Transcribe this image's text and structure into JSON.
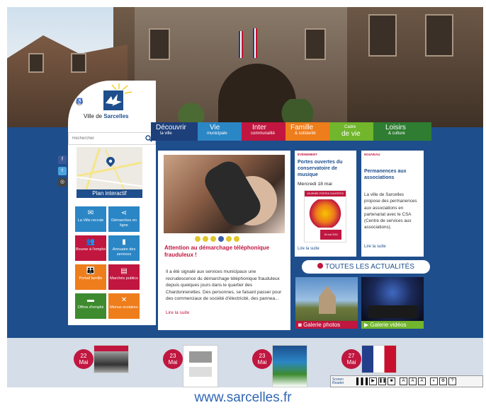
{
  "site": {
    "logo_text_prefix": "Ville de ",
    "logo_text_name": "Sarcelles",
    "footer_url": "www.sarcelles.fr"
  },
  "search": {
    "placeholder": "Rechercher"
  },
  "map": {
    "label": "Plan interactif"
  },
  "social": [
    {
      "name": "facebook",
      "glyph": "f",
      "color": "#3b5998"
    },
    {
      "name": "twitter",
      "glyph": "t",
      "color": "#4aa3df"
    },
    {
      "name": "instagram",
      "glyph": "◎",
      "color": "#444444"
    }
  ],
  "tiles": [
    {
      "label": "La Ville recrute",
      "glyph": "✉",
      "color": "#2b86c5"
    },
    {
      "label": "Démarches en ligne",
      "glyph": "⋖",
      "color": "#2b86c5"
    },
    {
      "label": "Bourse à l'emploi",
      "glyph": "👥",
      "color": "#c0163f"
    },
    {
      "label": "Annuaire des services",
      "glyph": "▮",
      "color": "#2b86c5"
    },
    {
      "label": "Portail famille",
      "glyph": "👪",
      "color": "#ee7d1b"
    },
    {
      "label": "Marchés publics",
      "glyph": "▤",
      "color": "#c0163f"
    },
    {
      "label": "Offres d'emploi",
      "glyph": "▬",
      "color": "#3d8b2e"
    },
    {
      "label": "Menus scolaires",
      "glyph": "✕",
      "color": "#ee7d1b"
    }
  ],
  "nav": [
    {
      "big": "Découvrir",
      "small": "la ville",
      "color": "#1d3f7a"
    },
    {
      "big": "Vie",
      "small": "municipale",
      "color": "#2b86c5"
    },
    {
      "big": "Inter",
      "small": "communalité",
      "color": "#c0163f"
    },
    {
      "big": "Famille",
      "small": "& solidarité",
      "color": "#ee7d1b"
    },
    {
      "big": "Cadre",
      "small": "de vie",
      "color": "#71b62c"
    },
    {
      "big": "Loisirs",
      "small": "& culture",
      "color": "#2e7d32"
    }
  ],
  "feature": {
    "title": "Attention au démarchage téléphonique frauduleux !",
    "body": "Il a été signalé aux services municipaux une recrudescence du démarchage téléphonique frauduleux depuis quelques jours dans le quartier des Chardonnerettes. Des personnes, se faisant passer pour des commerciaux de société d'électricité, des pannea...",
    "more": "Lire la suite",
    "active_dot": 4,
    "dot_count": 6
  },
  "cards": [
    {
      "tag": "ÉVÉNEMENT",
      "title": "Portes ouvertes du conservatoire de musique",
      "date": "Mercredi 18 mai",
      "poster_heading": "JOURNÉE PORTES OUVERTES",
      "poster_date": "18 mai 2016",
      "more": "Lire la suite"
    },
    {
      "tag": "NOUVEAU",
      "title": "Permanences aux associations",
      "body": "La ville de Sarcelles propose des permanences aux associations en partenariat avec le CSA (Centre de services aux associations).",
      "more": "Lire la suite"
    }
  ],
  "all_news": "TOUTES LES ACTUALITÉS",
  "galleries": [
    {
      "label": "Galerie photos",
      "color": "#c0163f"
    },
    {
      "label": "Galerie vidéos",
      "color": "#71b62c"
    }
  ],
  "bottom_events": [
    {
      "day": "22",
      "month": "Mai"
    },
    {
      "day": "23",
      "month": "Mai"
    },
    {
      "day": "23",
      "month": "Mai"
    },
    {
      "day": "27",
      "month": "Mai"
    }
  ],
  "reader": {
    "label_top": "Screen",
    "label_bottom": "Reader"
  }
}
